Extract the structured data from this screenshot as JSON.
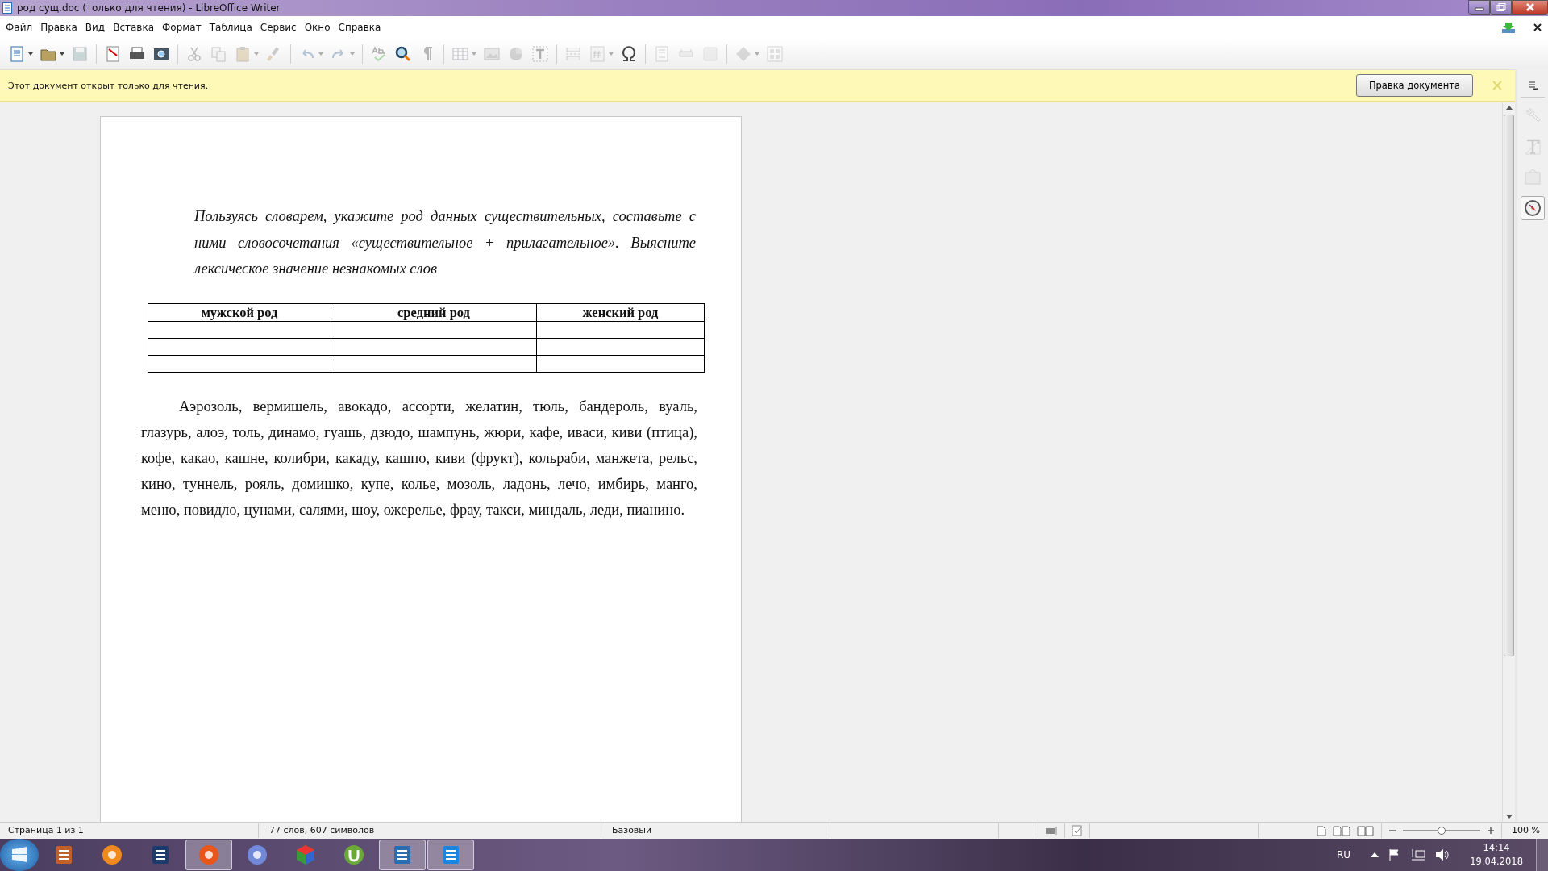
{
  "window": {
    "title": "род сущ.doc (только для чтения) - LibreOffice Writer"
  },
  "menu": [
    "Файл",
    "Правка",
    "Вид",
    "Вставка",
    "Формат",
    "Таблица",
    "Сервис",
    "Окно",
    "Справка"
  ],
  "toolbar": [
    {
      "kind": "new",
      "disabled": false,
      "dropdown": true
    },
    {
      "kind": "open",
      "disabled": false,
      "dropdown": true
    },
    {
      "kind": "save",
      "disabled": true,
      "dropdown": false
    },
    {
      "kind": "sep"
    },
    {
      "kind": "pdf",
      "disabled": false,
      "dropdown": false
    },
    {
      "kind": "print",
      "disabled": false,
      "dropdown": false
    },
    {
      "kind": "preview",
      "disabled": false,
      "dropdown": false
    },
    {
      "kind": "sep"
    },
    {
      "kind": "cut",
      "disabled": true,
      "dropdown": false
    },
    {
      "kind": "copy",
      "disabled": true,
      "dropdown": false
    },
    {
      "kind": "paste",
      "disabled": true,
      "dropdown": true
    },
    {
      "kind": "brush",
      "disabled": true,
      "dropdown": false
    },
    {
      "kind": "sep"
    },
    {
      "kind": "undo",
      "disabled": true,
      "dropdown": true
    },
    {
      "kind": "redo",
      "disabled": true,
      "dropdown": true
    },
    {
      "kind": "sep"
    },
    {
      "kind": "spell",
      "disabled": true,
      "dropdown": false
    },
    {
      "kind": "find",
      "disabled": false,
      "dropdown": false
    },
    {
      "kind": "pilcrow",
      "disabled": true,
      "dropdown": false
    },
    {
      "kind": "sep"
    },
    {
      "kind": "table",
      "disabled": true,
      "dropdown": true
    },
    {
      "kind": "image",
      "disabled": true,
      "dropdown": false
    },
    {
      "kind": "chart",
      "disabled": true,
      "dropdown": false
    },
    {
      "kind": "textbox",
      "disabled": true,
      "dropdown": false
    },
    {
      "kind": "sep"
    },
    {
      "kind": "pagebreak",
      "disabled": true,
      "dropdown": false
    },
    {
      "kind": "field",
      "disabled": true,
      "dropdown": true
    },
    {
      "kind": "omega",
      "disabled": false,
      "dropdown": false
    },
    {
      "kind": "sep"
    },
    {
      "kind": "note",
      "disabled": true,
      "dropdown": false
    },
    {
      "kind": "track",
      "disabled": true,
      "dropdown": false
    },
    {
      "kind": "comment",
      "disabled": true,
      "dropdown": false
    },
    {
      "kind": "sep"
    },
    {
      "kind": "shape",
      "disabled": true,
      "dropdown": true
    },
    {
      "kind": "grid",
      "disabled": true,
      "dropdown": false
    }
  ],
  "infobar": {
    "message": "Этот документ открыт только для чтения.",
    "button": "Правка документа"
  },
  "document": {
    "instruction": "Пользуясь словарем, укажите род данных существительных, составьте с ними словосочетания «существительное + прилагательное». Выясните лексическое значение незнакомых слов",
    "table": {
      "columns": [
        "мужской род",
        "средний род",
        "женский род"
      ]
    },
    "words": "Аэрозоль, вермишель, авокадо, ассорти, желатин, тюль, бандероль, вуаль, глазурь, алоэ, толь, динамо, гуашь, дзюдо, шампунь, жюри, кафе, иваси, киви (птица), кофе, какао, кашне, колибри, какаду, кашпо, киви (фрукт), кольраби, манжета, рельс, кино, туннель, рояль, домишко, купе, колье, мозоль, ладонь, лечо, имбирь, манго, меню, повидло, цунами, салями, шоу, ожерелье, фрау, такси, миндаль, леди, пианино."
  },
  "sidebar": [
    {
      "kind": "properties",
      "selected": false,
      "disabled": true
    },
    {
      "kind": "styles",
      "selected": false,
      "disabled": true
    },
    {
      "kind": "gallery",
      "selected": false,
      "disabled": true
    },
    {
      "kind": "navigator",
      "selected": true,
      "disabled": false
    }
  ],
  "status_bar": {
    "page": "Страница 1 из 1",
    "words": "77 слов, 607 символов",
    "style": "Базовый",
    "zoom": "100 %",
    "zoom_slider": {
      "level": 0.5
    }
  },
  "taskbar": {
    "apps": [
      {
        "kind": "impress",
        "highlighted": false
      },
      {
        "kind": "player",
        "highlighted": false
      },
      {
        "kind": "photoshop",
        "highlighted": false
      },
      {
        "kind": "firefox",
        "highlighted": true
      },
      {
        "kind": "discord",
        "highlighted": false
      },
      {
        "kind": "cube",
        "highlighted": false
      },
      {
        "kind": "torrent",
        "highlighted": false
      },
      {
        "kind": "writer",
        "highlighted": true
      },
      {
        "kind": "maxthon",
        "highlighted": true
      }
    ],
    "language": "RU",
    "time": "14:14",
    "date": "19.04.2018"
  }
}
